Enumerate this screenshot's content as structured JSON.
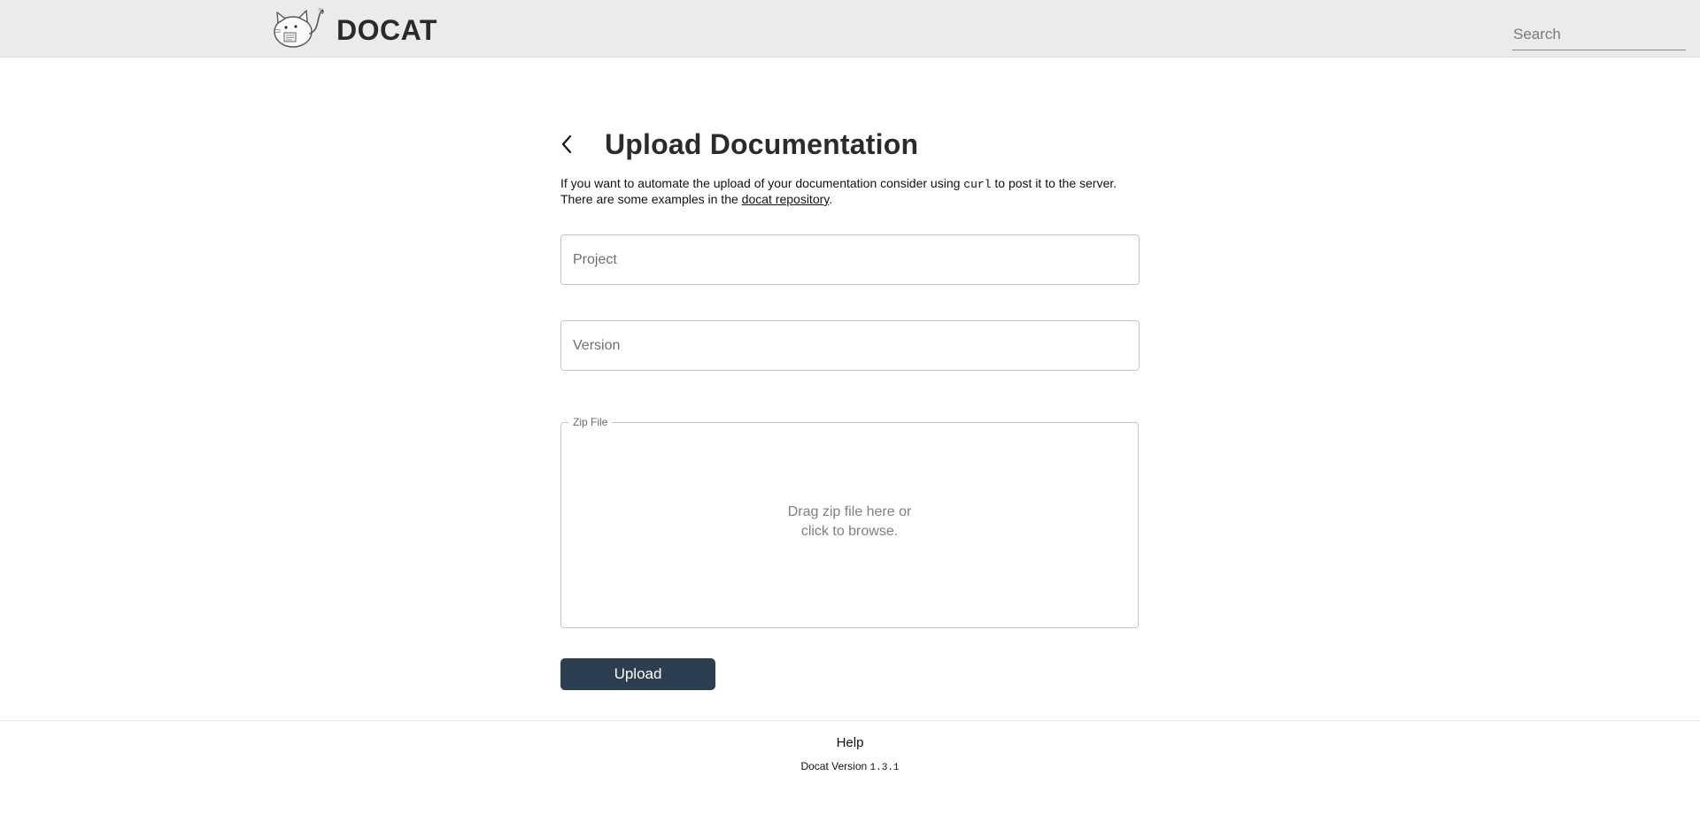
{
  "header": {
    "logo_icon": "docat-cat-logo-icon",
    "title": "DOCAT",
    "search": {
      "placeholder": "Search",
      "value": ""
    }
  },
  "main": {
    "back_icon": "chevron-left-icon",
    "title": "Upload Documentation",
    "intro": {
      "line1_prefix": "If you want to automate the upload of your documentation consider using ",
      "line1_code": "curl",
      "line1_suffix": " to post it to the server.",
      "line2_prefix": "There are some examples in the ",
      "line2_link": "docat repository",
      "line2_suffix": "."
    },
    "project_field": {
      "placeholder": "Project",
      "value": ""
    },
    "version_field": {
      "placeholder": "Version",
      "value": ""
    },
    "dropzone": {
      "legend": "Zip File",
      "line1": "Drag zip file here or",
      "line2": "click to browse."
    },
    "upload_label": "Upload"
  },
  "footer": {
    "help": "Help",
    "version_label": "Docat Version ",
    "version_value": "1.3.1"
  },
  "colors": {
    "header_bg": "#ebebeb",
    "button_bg": "#2d3e50",
    "border": "#c4c4c4"
  }
}
